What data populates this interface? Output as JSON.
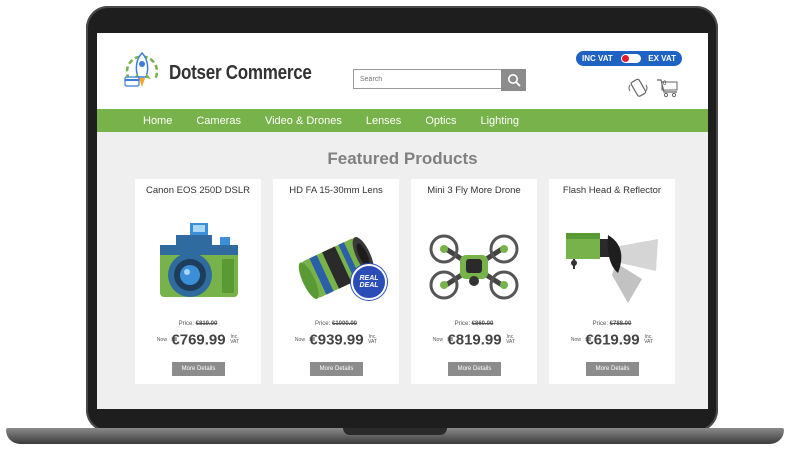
{
  "brand": {
    "name": "Dotser Commerce"
  },
  "search": {
    "placeholder": "Search"
  },
  "vat_toggle": {
    "inc_label": "INC VAT",
    "ex_label": "EX VAT",
    "state": "inc"
  },
  "cart": {
    "count": "0"
  },
  "nav": {
    "items": [
      "Home",
      "Cameras",
      "Video & Drones",
      "Lenses",
      "Optics",
      "Lighting"
    ]
  },
  "section": {
    "title": "Featured Products"
  },
  "products": [
    {
      "name": "Canon EOS 250D DSLR",
      "was_label": "Price",
      "was": "€819.00",
      "now_label": "Now",
      "now": "€769.99",
      "vat_line1": "Inc.",
      "vat_line2": "VAT",
      "button": "More Details"
    },
    {
      "name": "HD FA 15-30mm Lens",
      "was_label": "Price",
      "was": "€1000.00",
      "now_label": "Now",
      "now": "€939.99",
      "vat_line1": "Inc.",
      "vat_line2": "VAT",
      "button": "More Details",
      "badge_line1": "REAL",
      "badge_line2": "DEAL"
    },
    {
      "name": "Mini 3 Fly More Drone",
      "was_label": "Price",
      "was": "€860.00",
      "now_label": "Now",
      "now": "€819.99",
      "vat_line1": "Inc.",
      "vat_line2": "VAT",
      "button": "More Details"
    },
    {
      "name": "Flash Head & Reflector",
      "was_label": "Price",
      "was": "€788.00",
      "now_label": "Now",
      "now": "€619.99",
      "vat_line1": "Inc.",
      "vat_line2": "VAT",
      "button": "More Details"
    }
  ],
  "colors": {
    "nav_green": "#78b24a",
    "toggle_blue": "#1e63c4",
    "toggle_knob": "#e01c2f",
    "button_grey": "#8c8c8c"
  },
  "icons": [
    "rocket-logo-icon",
    "search-icon",
    "phone-icon",
    "cart-icon"
  ]
}
